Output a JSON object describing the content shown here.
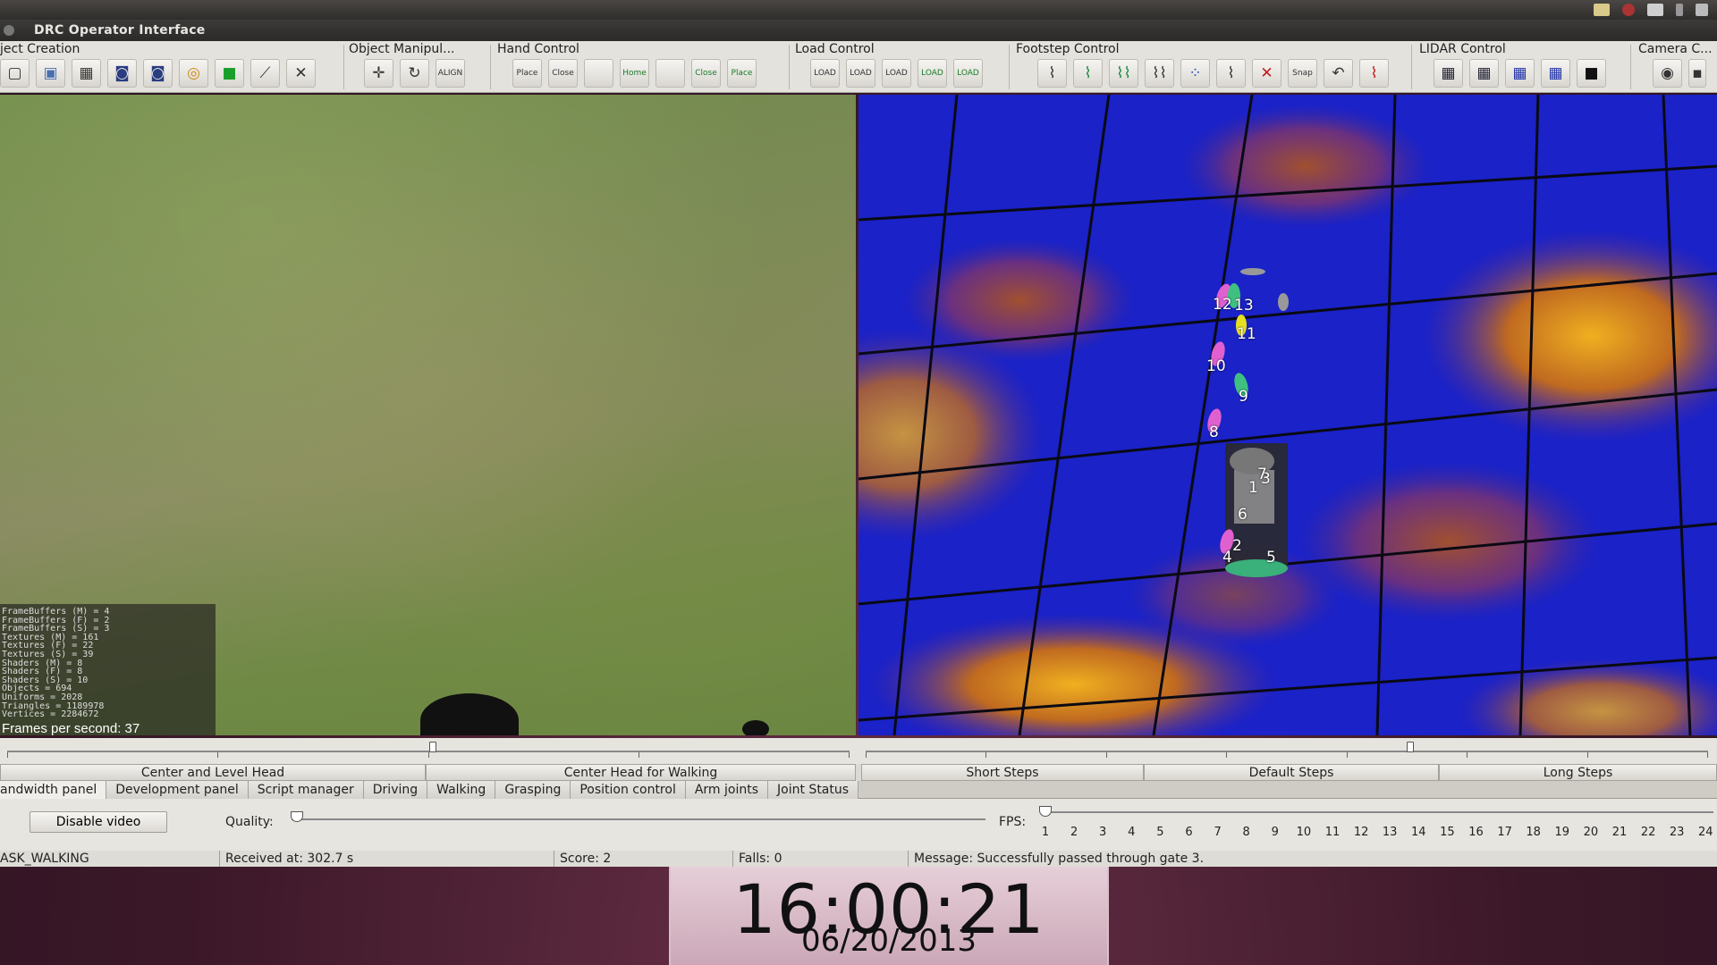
{
  "window": {
    "title": "DRC Operator Interface"
  },
  "toolbar": {
    "groups": [
      {
        "label": "ject Creation",
        "icons": [
          "cursor-icon",
          "box-icon",
          "wall-icon",
          "vehicle-icon",
          "update-vehicle-icon",
          "ring-icon",
          "green-block-icon",
          "drill-icon",
          "valve-icon"
        ]
      },
      {
        "label": "Object Manipul...",
        "icons": [
          "move-icon",
          "rotate-icon",
          "align-icon"
        ]
      },
      {
        "label": "Hand Control",
        "icons": [
          "hand-place-icon",
          "hand-close-icon",
          "hand-blank-icon",
          "hand-home-icon",
          "hand-blank-icon",
          "hand-close-icon",
          "hand-place-icon"
        ]
      },
      {
        "label": "Load Control",
        "icons": [
          "load-icon",
          "load-icon",
          "load-icon",
          "load-icon",
          "load-icon"
        ]
      },
      {
        "label": "Footstep Control",
        "icons": [
          "footstep-icon",
          "footstep-icon",
          "footstep-icon",
          "footstep-icon",
          "footstep-icon",
          "footstep-icon",
          "delete-footstep-icon",
          "snap-icon",
          "footstep-icon",
          "footstep-icon"
        ]
      },
      {
        "label": "LIDAR Control",
        "icons": [
          "lidar-icon",
          "lidar-clear-icon",
          "lidar-icon",
          "lidar-icon",
          "lidar-dark-icon"
        ]
      },
      {
        "label": "Camera C...",
        "icons": [
          "eye-icon",
          "camera-icon"
        ]
      }
    ],
    "text": {
      "align": "ALIGN",
      "place": "Place",
      "close": "Close",
      "home": "Home",
      "load": "LOAD",
      "snap": "Snap"
    }
  },
  "camera": {
    "stats": [
      "FrameBuffers (M) = 4",
      "FrameBuffers (F) = 2",
      "FrameBuffers (S) = 3",
      "Textures (M) = 161",
      "Textures (F) = 22",
      "Textures (S) = 39",
      "Shaders (M) = 8",
      "Shaders (F) = 8",
      "Shaders (S) = 10",
      "Objects = 694",
      "Uniforms = 2028",
      "Triangles = 1189978",
      "Vertices = 2284672"
    ],
    "fps_text": "Frames per second: 37"
  },
  "lidar": {
    "footsteps": [
      "1",
      "2",
      "3",
      "4",
      "5",
      "6",
      "7",
      "8",
      "9",
      "10",
      "11",
      "12",
      "13"
    ]
  },
  "head_buttons": [
    "Center and Level Head",
    "Center Head for Walking"
  ],
  "step_buttons": [
    "Short Steps",
    "Default Steps",
    "Long Steps"
  ],
  "tabs": [
    "andwidth panel",
    "Development panel",
    "Script manager",
    "Driving",
    "Walking",
    "Grasping",
    "Position control",
    "Arm joints",
    "Joint Status"
  ],
  "bandwidth": {
    "video_button": "Disable video",
    "quality_label": "Quality:",
    "fps_label": "FPS:",
    "fps_values": [
      "1",
      "2",
      "3",
      "4",
      "5",
      "6",
      "7",
      "8",
      "9",
      "10",
      "11",
      "12",
      "13",
      "14",
      "15",
      "16",
      "17",
      "18",
      "19",
      "20",
      "21",
      "22",
      "23",
      "24"
    ]
  },
  "status": {
    "task": "ASK_WALKING",
    "received": "Received at:  302.7 s",
    "score": "Score:  2",
    "falls": "Falls:  0",
    "message": "Message:  Successfully passed through gate 3."
  },
  "clock": {
    "time": "16:00:21",
    "date": "06/20/2013"
  }
}
